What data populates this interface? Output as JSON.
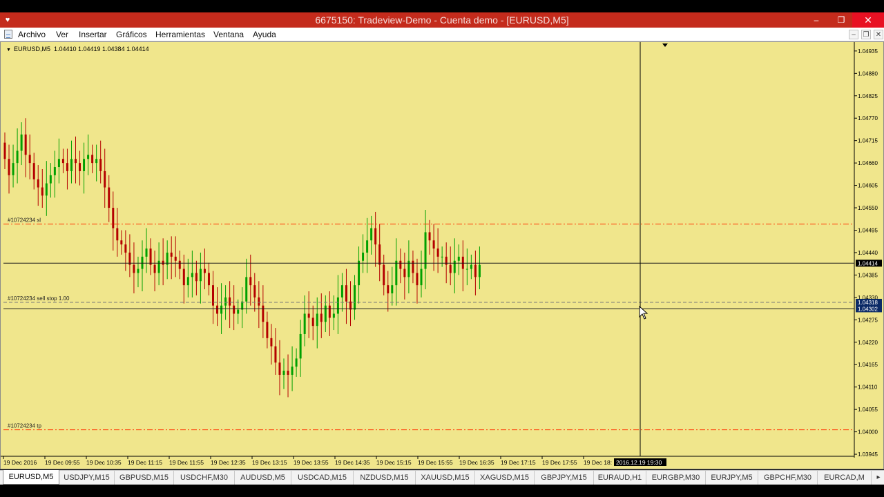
{
  "window": {
    "title": "6675150: Tradeview-Demo - Cuenta demo - [EURUSD,M5]",
    "app_icon": "metatrader-icon",
    "minimize_glyph": "–",
    "restore_glyph": "❐",
    "close_glyph": "✕"
  },
  "menu": {
    "items": [
      "Archivo",
      "Ver",
      "Insertar",
      "Gráficos",
      "Herramientas",
      "Ventana",
      "Ayuda"
    ],
    "mdi_buttons": [
      "–",
      "❐",
      "✕"
    ]
  },
  "chart_header": {
    "symbol": "EURUSD,M5",
    "ohlc": "1.04410 1.04419 1.04384 1.04414"
  },
  "colors": {
    "background": "#f0e68c",
    "bull_candle": "#00a000",
    "bear_candle": "#b40000",
    "order_line": "#ff3300",
    "title_bar": "#c42b1c"
  },
  "chart_data": {
    "type": "candlestick",
    "symbol": "EURUSD",
    "timeframe": "M5",
    "ylim": [
      1.0394,
      1.0495
    ],
    "y_ticks": [
      "1.04935",
      "1.04880",
      "1.04825",
      "1.04770",
      "1.04715",
      "1.04660",
      "1.04605",
      "1.04550",
      "1.04495",
      "1.04440",
      "1.04385",
      "1.04330",
      "1.04275",
      "1.04220",
      "1.04165",
      "1.04110",
      "1.04055",
      "1.04000",
      "1.03945"
    ],
    "x_ticks": [
      "19 Dec 2016",
      "19 Dec 09:55",
      "19 Dec 10:35",
      "19 Dec 11:15",
      "19 Dec 11:55",
      "19 Dec 12:35",
      "19 Dec 13:15",
      "19 Dec 13:55",
      "19 Dec 14:35",
      "19 Dec 15:15",
      "19 Dec 15:55",
      "19 Dec 16:35",
      "19 Dec 17:15",
      "19 Dec 17:55",
      "19 Dec 18:"
    ],
    "closes": [
      1.0467,
      1.0463,
      1.0466,
      1.0469,
      1.0473,
      1.0468,
      1.0466,
      1.0462,
      1.046,
      1.0458,
      1.0461,
      1.0463,
      1.0465,
      1.0467,
      1.0466,
      1.0464,
      1.0467,
      1.0466,
      1.0464,
      1.0467,
      1.0468,
      1.0466,
      1.0467,
      1.0464,
      1.046,
      1.0455,
      1.045,
      1.0447,
      1.0446,
      1.0444,
      1.0441,
      1.0439,
      1.044,
      1.0443,
      1.0445,
      1.0441,
      1.0439,
      1.0442,
      1.0441,
      1.0444,
      1.0443,
      1.0442,
      1.044,
      1.0436,
      1.0438,
      1.0439,
      1.0437,
      1.044,
      1.0439,
      1.0436,
      1.0431,
      1.0429,
      1.0431,
      1.0433,
      1.0431,
      1.0429,
      1.043,
      1.0432,
      1.0438,
      1.0436,
      1.0433,
      1.0431,
      1.0427,
      1.0423,
      1.0421,
      1.0417,
      1.0414,
      1.0415,
      1.0414,
      1.0416,
      1.0418,
      1.0424,
      1.0429,
      1.0428,
      1.0426,
      1.0429,
      1.0427,
      1.0431,
      1.0428,
      1.0429,
      1.0433,
      1.0436,
      1.0432,
      1.043,
      1.0436,
      1.0442,
      1.0444,
      1.0447,
      1.045,
      1.0446,
      1.0441,
      1.0436,
      1.0434,
      1.0436,
      1.0442,
      1.044,
      1.0438,
      1.0442,
      1.0439,
      1.0436,
      1.044,
      1.0449,
      1.0447,
      1.0445,
      1.0443,
      1.0443,
      1.0441,
      1.0439,
      1.0442,
      1.0443,
      1.044,
      1.044,
      1.0441,
      1.0438,
      1.0441
    ],
    "lines": [
      {
        "label": "#10724234 sl",
        "price": 1.0451,
        "style": "dash-dot"
      },
      {
        "label": "#10724234 tp",
        "price": 1.04005,
        "style": "dash-dot"
      },
      {
        "label": "#10724234 sell stop 1.00",
        "price": 1.04318,
        "style": "dashed"
      },
      {
        "label": "",
        "price": 1.04414,
        "style": "solid"
      }
    ],
    "price_labels": [
      "1.04414",
      "1.04318",
      "1.04302"
    ],
    "crosshair_time_label": "2016.12.19 19:30"
  },
  "tabs": [
    "EURUSD,M5",
    "USDJPY,M15",
    "GBPUSD,M15",
    "USDCHF,M30",
    "AUDUSD,M5",
    "USDCAD,M15",
    "NZDUSD,M15",
    "XAUUSD,M15",
    "XAGUSD,M15",
    "GBPJPY,M15",
    "EURAUD,H1",
    "EURGBP,M30",
    "EURJPY,M5",
    "GBPCHF,M30",
    "EURCAD,M"
  ],
  "tab_scroll_glyph": "▸"
}
